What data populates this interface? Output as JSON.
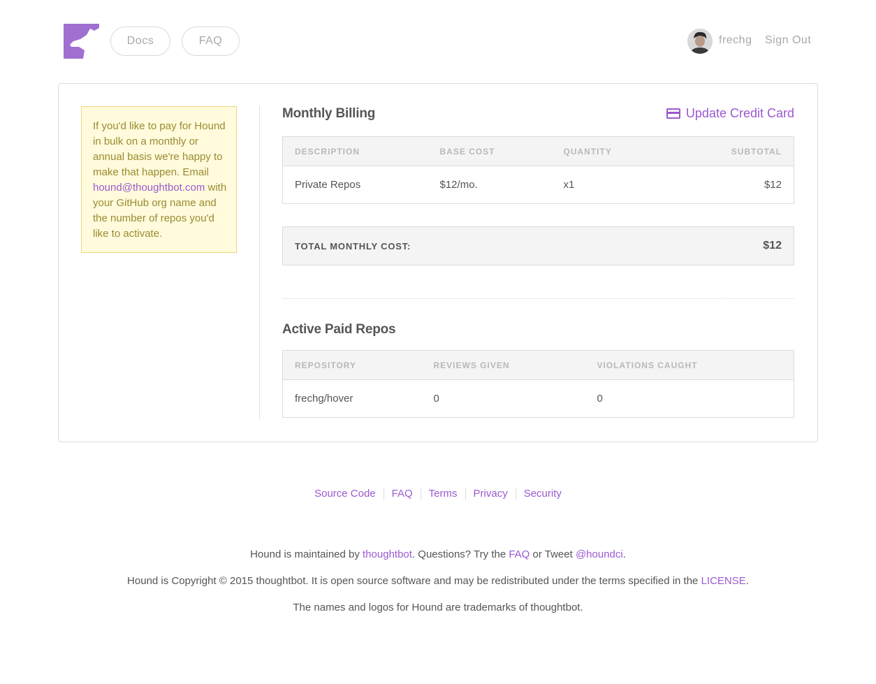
{
  "header": {
    "nav": {
      "docs": "Docs",
      "faq": "FAQ"
    },
    "user": {
      "name": "frechg",
      "sign_out": "Sign Out"
    }
  },
  "notice": {
    "text_before": "If you'd like to pay for Hound in bulk on a monthly or annual basis we're happy to make that happen. Email ",
    "email": "hound@thoughtbot.com",
    "text_after": " with your GitHub org name and the number of repos you'd like to activate."
  },
  "billing": {
    "title": "Monthly Billing",
    "update_card": "Update Credit Card",
    "columns": [
      "DESCRIPTION",
      "BASE COST",
      "QUANTITY",
      "SUBTOTAL"
    ],
    "rows": [
      {
        "description": "Private Repos",
        "base_cost": "$12/mo.",
        "quantity": "x1",
        "subtotal": "$12"
      }
    ],
    "total_label": "TOTAL MONTHLY COST:",
    "total_value": "$12"
  },
  "repos": {
    "title": "Active Paid Repos",
    "columns": [
      "REPOSITORY",
      "REVIEWS GIVEN",
      "VIOLATIONS CAUGHT"
    ],
    "rows": [
      {
        "repository": "frechg/hover",
        "reviews": "0",
        "violations": "0"
      }
    ]
  },
  "footer": {
    "links": [
      "Source Code",
      "FAQ",
      "Terms",
      "Privacy",
      "Security"
    ],
    "line1": {
      "a": "Hound is maintained by ",
      "thoughtbot": "thoughtbot",
      "b": ". Questions? Try the ",
      "faq": "FAQ",
      "c": " or Tweet ",
      "handle": "@houndci",
      "d": "."
    },
    "line2": {
      "a": "Hound is Copyright © 2015 thoughtbot. It is open source software and may be redistributed under the terms specified in the ",
      "license": "LICENSE",
      "b": "."
    },
    "line3": "The names and logos for Hound are trademarks of thoughtbot."
  },
  "colors": {
    "accent": "#9b59d0",
    "logo": "#a070d0",
    "notice_bg": "#fffbdc",
    "notice_border": "#efd87c"
  }
}
